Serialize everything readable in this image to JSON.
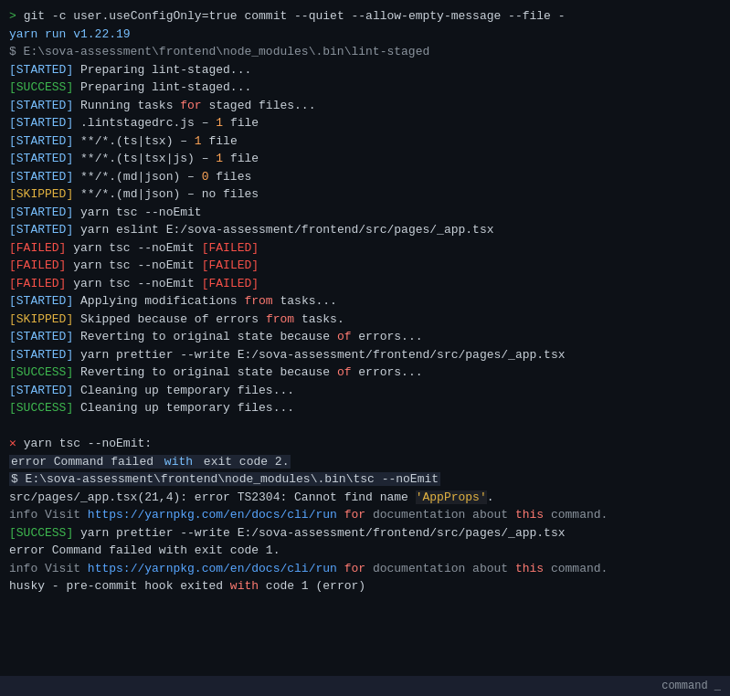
{
  "terminal": {
    "lines": [
      {
        "id": "l1",
        "text": "> git -c user.useConfigOnly=true commit --quiet --allow-empty-message --file -",
        "type": "cmd"
      },
      {
        "id": "l2",
        "text": "yarn run v1.22.19",
        "type": "yarn-version"
      },
      {
        "id": "l3",
        "text": "$ E:\\sova-assessment\\frontend\\node_modules\\.bin\\lint-staged",
        "type": "exec"
      },
      {
        "id": "l4",
        "text": "[STARTED] Preparing lint-staged...",
        "type": "started"
      },
      {
        "id": "l5",
        "text": "[SUCCESS] Preparing lint-staged...",
        "type": "success"
      },
      {
        "id": "l6",
        "text": "[STARTED] Running tasks for staged files...",
        "type": "started-for"
      },
      {
        "id": "l7",
        "text": "[STARTED] .lintstagedrc.js – 1 file",
        "type": "started"
      },
      {
        "id": "l8",
        "text": "[STARTED] **/*.(ts|tsx) – 1 file",
        "type": "started"
      },
      {
        "id": "l9",
        "text": "[STARTED] **/*.(ts|tsx|js) – 1 file",
        "type": "started"
      },
      {
        "id": "l10",
        "text": "[STARTED] **/*.(md|json) – 0 files",
        "type": "started"
      },
      {
        "id": "l11",
        "text": "[SKIPPED] **/*.(md|json) – no files",
        "type": "skipped"
      },
      {
        "id": "l12",
        "text": "[STARTED] yarn tsc --noEmit",
        "type": "started"
      },
      {
        "id": "l13",
        "text": "[STARTED] yarn eslint E:/sova-assessment/frontend/src/pages/_app.tsx",
        "type": "started-path"
      },
      {
        "id": "l14",
        "text": "[FAILED] yarn tsc --noEmit [FAILED]",
        "type": "failed"
      },
      {
        "id": "l15",
        "text": "[FAILED] yarn tsc --noEmit [FAILED]",
        "type": "failed"
      },
      {
        "id": "l16",
        "text": "[FAILED] yarn tsc --noEmit [FAILED]",
        "type": "failed"
      },
      {
        "id": "l17",
        "text": "[STARTED] Applying modifications from tasks...",
        "type": "started-from"
      },
      {
        "id": "l18",
        "text": "[SKIPPED] Skipped because of errors from tasks.",
        "type": "skipped-from"
      },
      {
        "id": "l19",
        "text": "[STARTED] Reverting to original state because of errors...",
        "type": "started-because"
      },
      {
        "id": "l20",
        "text": "[STARTED] yarn prettier --write E:/sova-assessment/frontend/src/pages/_app.tsx",
        "type": "started-path2"
      },
      {
        "id": "l21",
        "text": "[SUCCESS] Reverting to original state because of errors...",
        "type": "success-because"
      },
      {
        "id": "l22",
        "text": "[STARTED] Cleaning up temporary files...",
        "type": "started"
      },
      {
        "id": "l23",
        "text": "[SUCCESS] Cleaning up temporary files...",
        "type": "success"
      },
      {
        "id": "l24",
        "text": "",
        "type": "blank"
      },
      {
        "id": "l25",
        "text": "✕ yarn tsc --noEmit:",
        "type": "cross"
      },
      {
        "id": "l26",
        "text": "error Command failed with exit code 2.",
        "type": "error-highlight"
      },
      {
        "id": "l27",
        "text": "$ E:\\sova-assessment\\frontend\\node_modules\\.bin\\tsc --noEmit",
        "type": "exec-highlight"
      },
      {
        "id": "l28",
        "text": "src/pages/_app.tsx(21,4): error TS2304: Cannot find name 'AppProps'.",
        "type": "ts-error"
      },
      {
        "id": "l29",
        "text": "info Visit https://yarnpkg.com/en/docs/cli/run for documentation about this command.",
        "type": "info-visit"
      },
      {
        "id": "l30",
        "text": "[SUCCESS] yarn prettier --write E:/sova-assessment/frontend/src/pages/_app.tsx",
        "type": "success-path"
      },
      {
        "id": "l31",
        "text": "error Command failed with exit code 1.",
        "type": "error-plain"
      },
      {
        "id": "l32",
        "text": "info Visit https://yarnpkg.com/en/docs/cli/run for documentation about this command.",
        "type": "info-visit2"
      },
      {
        "id": "l33",
        "text": "husky - pre-commit hook exited with code 1 (error)",
        "type": "husky"
      }
    ],
    "status_bar": {
      "label": "command _"
    }
  }
}
